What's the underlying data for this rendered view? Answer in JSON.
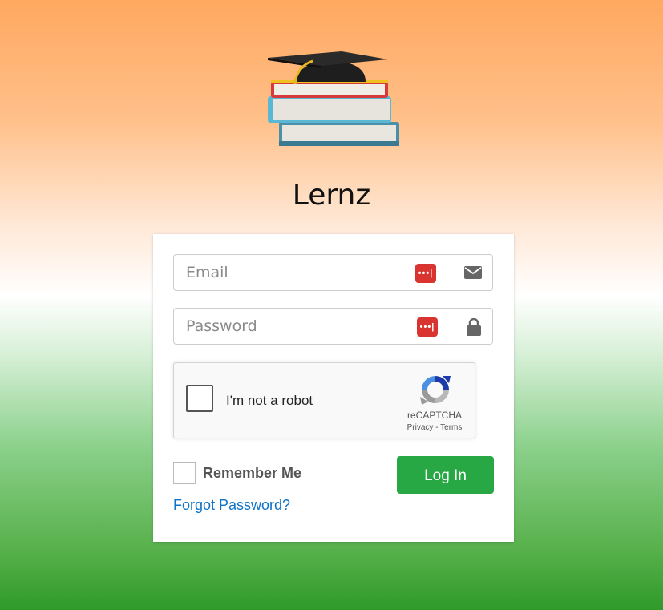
{
  "app": {
    "title": "Lernz"
  },
  "login_form": {
    "email": {
      "placeholder": "Email",
      "value": ""
    },
    "password": {
      "placeholder": "Password",
      "value": ""
    },
    "recaptcha": {
      "label": "I'm not a robot",
      "brand": "reCAPTCHA",
      "links": "Privacy - Terms"
    },
    "remember_label": "Remember Me",
    "login_label": "Log In",
    "forgot_label": "Forgot Password?"
  },
  "icons": {
    "logo": "graduation-cap-books",
    "email": "envelope-icon",
    "password": "lock-icon",
    "password_manager": "lastpass-icon"
  },
  "colors": {
    "login_button": "#28a745",
    "link": "#0d73c8",
    "password_manager": "#d9342f"
  }
}
